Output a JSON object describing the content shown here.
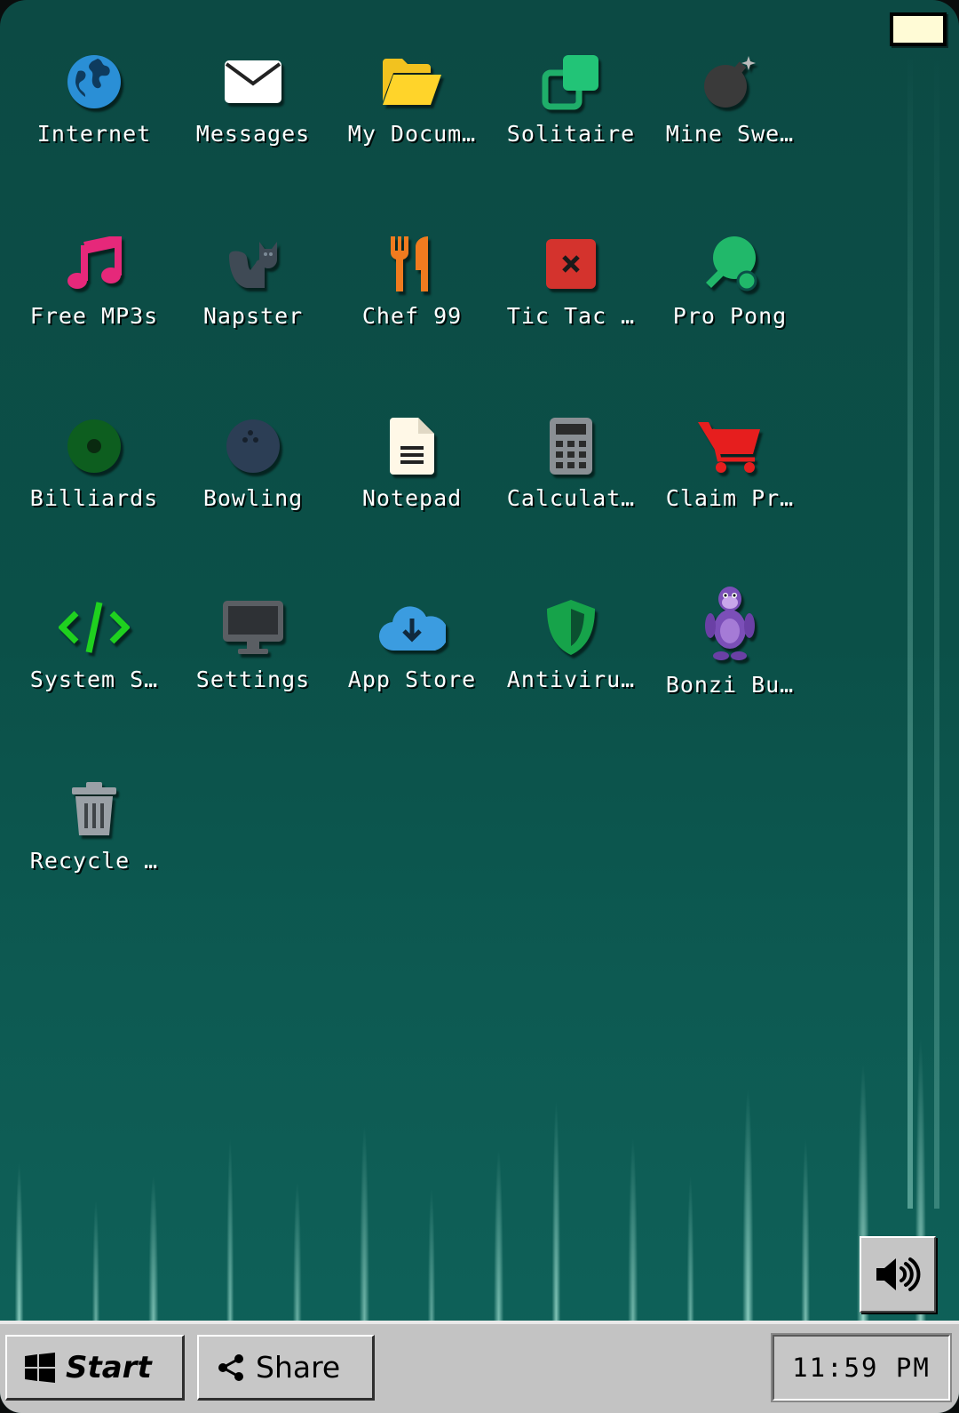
{
  "desktop": {
    "icons": [
      {
        "label": "Internet",
        "icon": "globe-icon"
      },
      {
        "label": "Messages",
        "icon": "envelope-icon"
      },
      {
        "label": "My Docum…",
        "icon": "folder-icon"
      },
      {
        "label": "Solitaire",
        "icon": "cards-icon"
      },
      {
        "label": "Mine Swe…",
        "icon": "bomb-icon"
      },
      {
        "label": "Free MP3s",
        "icon": "music-note-icon"
      },
      {
        "label": "Napster",
        "icon": "cat-icon"
      },
      {
        "label": "Chef 99",
        "icon": "utensils-icon"
      },
      {
        "label": "Tic Tac …",
        "icon": "x-square-icon"
      },
      {
        "label": "Pro Pong",
        "icon": "ping-pong-icon"
      },
      {
        "label": "Billiards",
        "icon": "billiard-ball-icon"
      },
      {
        "label": "Bowling",
        "icon": "bowling-ball-icon"
      },
      {
        "label": "Notepad",
        "icon": "document-icon"
      },
      {
        "label": "Calculat…",
        "icon": "calculator-icon"
      },
      {
        "label": "Claim Pr…",
        "icon": "shopping-cart-icon"
      },
      {
        "label": "System S…",
        "icon": "code-icon"
      },
      {
        "label": "Settings",
        "icon": "monitor-icon"
      },
      {
        "label": "App Store",
        "icon": "cloud-download-icon"
      },
      {
        "label": "Antiviru…",
        "icon": "shield-icon"
      },
      {
        "label": "Bonzi Bu…",
        "icon": "purple-gorilla-icon"
      },
      {
        "label": "Recycle …",
        "icon": "trash-icon"
      }
    ]
  },
  "taskbar": {
    "start_label": "Start",
    "share_label": "Share",
    "clock": "11:59 PM"
  },
  "colors": {
    "desktop_bg": "#0c4a44",
    "taskbar_bg": "#c3c3c3",
    "notification": "#fffbd6"
  }
}
